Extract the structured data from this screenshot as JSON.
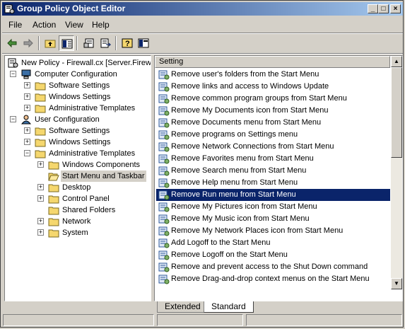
{
  "window": {
    "title": "Group Policy Object Editor"
  },
  "menu": [
    "File",
    "Action",
    "View",
    "Help"
  ],
  "toolbar": {
    "icons": [
      "back-arrow-icon",
      "forward-arrow-icon",
      "up-folder-icon",
      "show-hide-tree-icon",
      "properties-icon",
      "export-list-icon",
      "help-icon",
      "extended-view-icon"
    ]
  },
  "tree": {
    "root": "New Policy - Firewall.cx [Server.Firewall",
    "computer_config": "Computer Configuration",
    "cc_software": "Software Settings",
    "cc_windows": "Windows Settings",
    "cc_admin": "Administrative Templates",
    "user_config": "User Configuration",
    "uc_software": "Software Settings",
    "uc_windows": "Windows Settings",
    "uc_admin": "Administrative Templates",
    "windows_components": "Windows Components",
    "start_menu": "Start Menu and Taskbar",
    "desktop": "Desktop",
    "control_panel": "Control Panel",
    "shared_folders": "Shared Folders",
    "network": "Network",
    "system": "System"
  },
  "list": {
    "column": "Setting",
    "rows": [
      "Remove user's folders from the Start Menu",
      "Remove links and access to Windows Update",
      "Remove common program groups from Start Menu",
      "Remove My Documents icon from Start Menu",
      "Remove Documents menu from Start Menu",
      "Remove programs on Settings menu",
      "Remove Network Connections from Start Menu",
      "Remove Favorites menu from Start Menu",
      "Remove Search menu from Start Menu",
      "Remove Help menu from Start Menu",
      "Remove Run menu from Start Menu",
      "Remove My Pictures icon from Start Menu",
      "Remove My Music icon from Start Menu",
      "Remove My Network Places icon from Start Menu",
      "Add Logoff to the Start Menu",
      "Remove Logoff on the Start Menu",
      "Remove and prevent access to the Shut Down command",
      "Remove Drag-and-drop context menus on the Start Menu"
    ],
    "selected_index": 10
  },
  "tabs": {
    "extended": "Extended",
    "standard": "Standard"
  },
  "colors": {
    "title_start": "#0a246a",
    "title_end": "#a6caf0",
    "selection": "#0a246a",
    "folder": "#f5d76e"
  }
}
